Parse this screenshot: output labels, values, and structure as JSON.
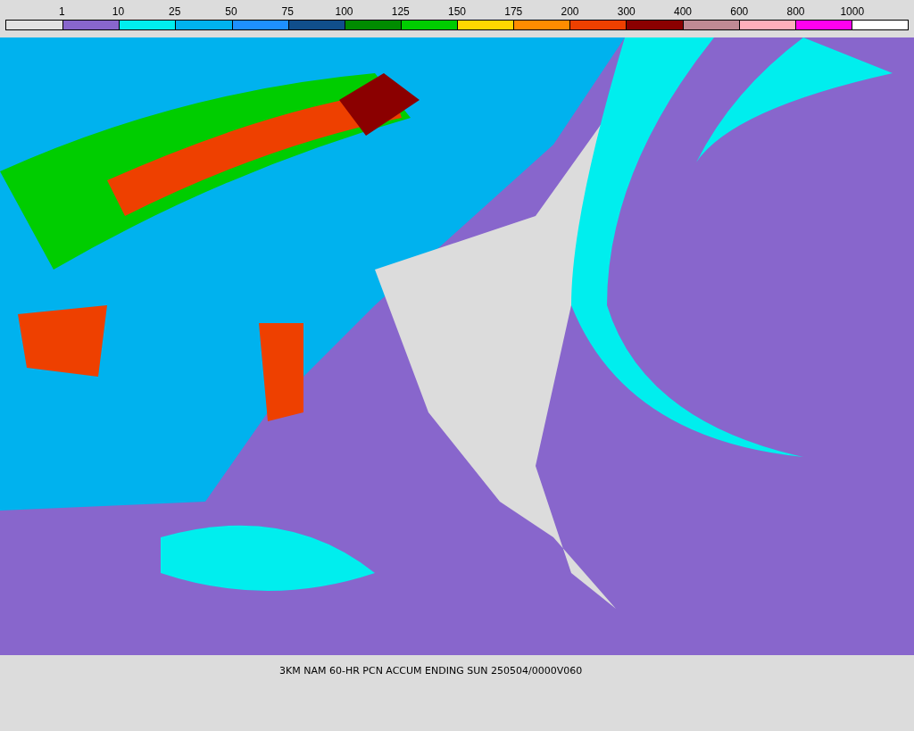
{
  "legend": [
    {
      "color": "#e2e2e2"
    },
    {
      "label": "1",
      "color": "#8866cc"
    },
    {
      "label": "10",
      "color": "#00eeee"
    },
    {
      "label": "25",
      "color": "#00b2ee"
    },
    {
      "label": "50",
      "color": "#1e90ff"
    },
    {
      "label": "75",
      "color": "#104e8b"
    },
    {
      "label": "100",
      "color": "#008b00"
    },
    {
      "label": "125",
      "color": "#00cd00"
    },
    {
      "label": "150",
      "color": "#ffd700"
    },
    {
      "label": "175",
      "color": "#ff8c00"
    },
    {
      "label": "200",
      "color": "#ee4000"
    },
    {
      "label": "300",
      "color": "#8b0000"
    },
    {
      "label": "400",
      "color": "#c08a94"
    },
    {
      "label": "600",
      "color": "#ffaebb"
    },
    {
      "label": "800",
      "color": "#ff00ee"
    },
    {
      "label": "1000",
      "color": "#ffffff"
    }
  ],
  "caption": "3KM NAM 60-HR PCN ACCUM ENDING SUN 250504/0000V060"
}
